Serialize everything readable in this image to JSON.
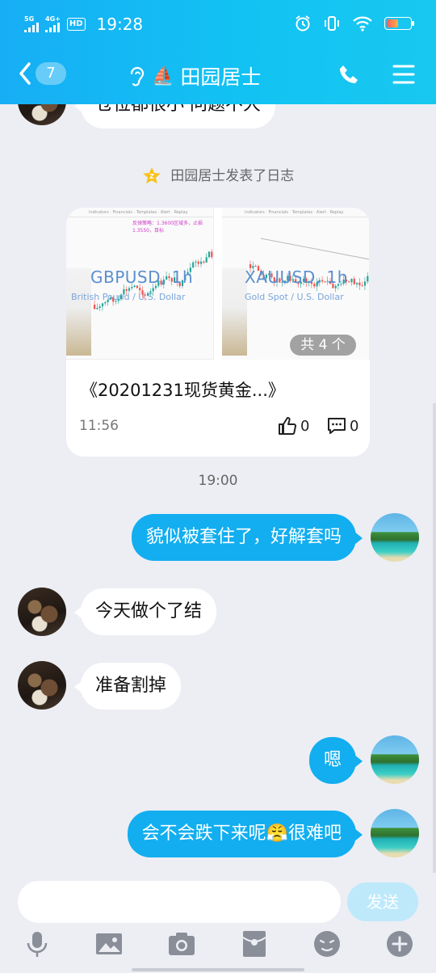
{
  "status_bar": {
    "network_1": "5G",
    "network_2": "4G+",
    "hd_label": "HD",
    "time": "19:28"
  },
  "header": {
    "unread_count": "7",
    "contact_name": "田园居士",
    "boat_emoji": "⛵"
  },
  "chat": {
    "partial_top_message": "仓位都很小 问题不大",
    "system_notice": "田园居士发表了日志",
    "post_card": {
      "title": "《20201231现货黄金...》",
      "time": "11:56",
      "likes": "0",
      "comments": "0",
      "image_count_badge": "共 4 个",
      "thumb1": {
        "symbol": "GBPUSD, 1h",
        "subtitle": "British Pound / U.S. Dollar",
        "note": "反弹策略：1.3600区域多，止损1.3550，目标"
      },
      "thumb2": {
        "symbol": "XAUUSD, 1h",
        "subtitle": "Gold Spot / U.S. Dollar"
      }
    },
    "timestamp": "19:00",
    "messages": [
      {
        "side": "out",
        "text": "貌似被套住了，好解套吗"
      },
      {
        "side": "in",
        "text": "今天做个了结"
      },
      {
        "side": "in",
        "text": "准备割掉"
      },
      {
        "side": "out",
        "text": "嗯"
      },
      {
        "side": "out",
        "text_before": "会不会跌下来呢",
        "emoji": "😤",
        "text_after": "很难吧"
      }
    ]
  },
  "input_bar": {
    "send_label": "发送",
    "tool_icons": [
      "microphone-icon",
      "image-icon",
      "camera-icon",
      "red-packet-icon",
      "emoji-icon",
      "plus-icon"
    ]
  },
  "colors": {
    "header_blue": "#17aef5",
    "bubble_out": "#12aef0",
    "bubble_in": "#ffffff",
    "background": "#eceef4"
  }
}
